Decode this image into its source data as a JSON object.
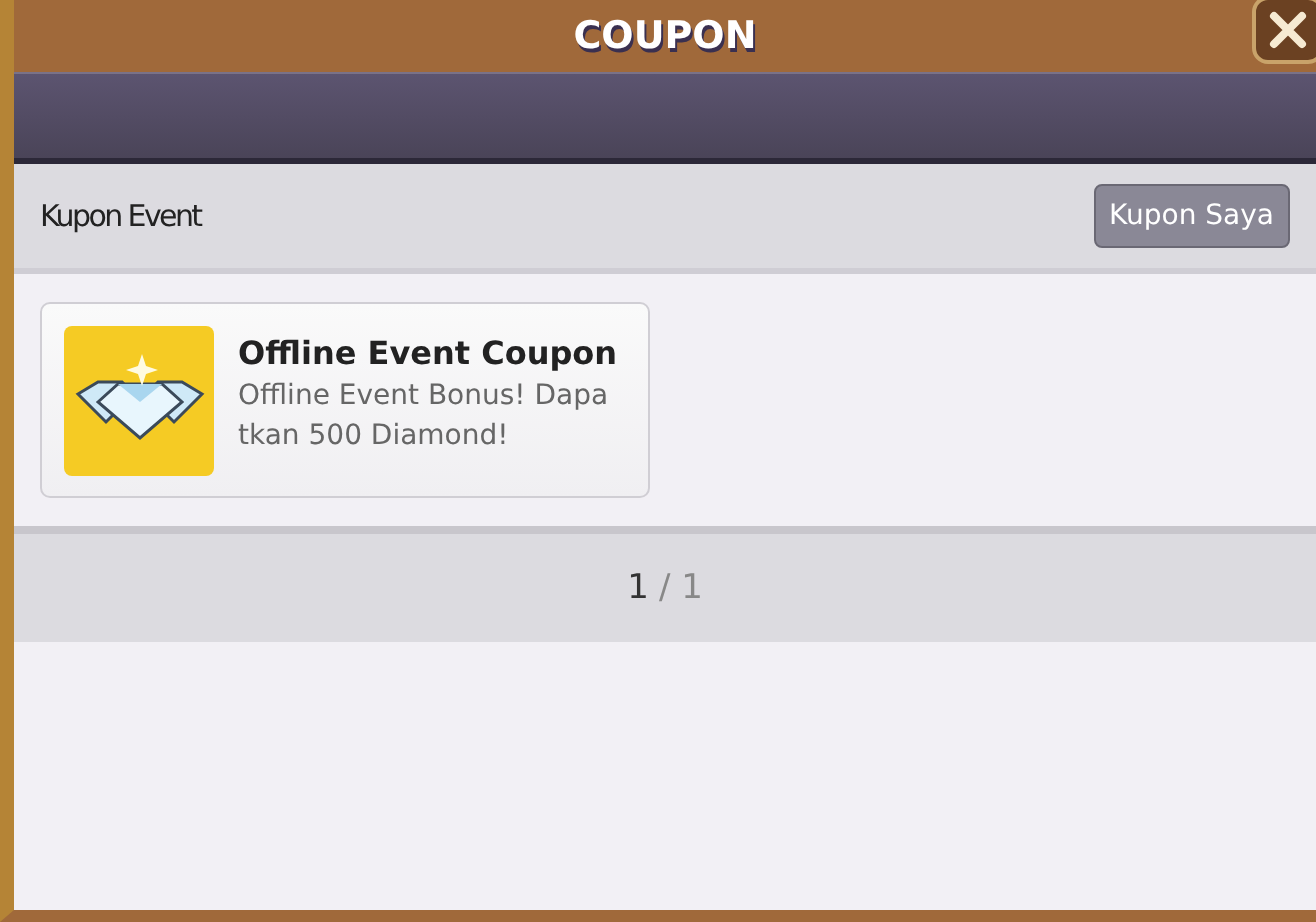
{
  "window": {
    "title": "COUPON"
  },
  "header": {
    "title": "Kupon Event",
    "button": "Kupon Saya"
  },
  "coupons": [
    {
      "title": "Offline Event Coupon",
      "description": "Offline Event Bonus! Dapa\ntkan 500 Diamond!"
    }
  ],
  "pager": {
    "current": "1",
    "separator": "/",
    "total": "1"
  }
}
